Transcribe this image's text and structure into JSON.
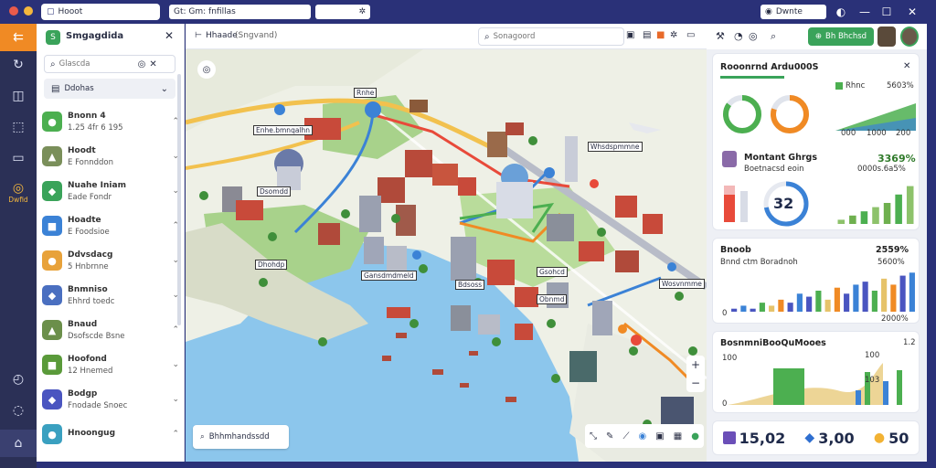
{
  "window": {
    "app_title": "Hooot",
    "tab_title": "Gt: Gm: fnfillas",
    "user_label": "Dwnte"
  },
  "rail": {
    "active_label": "Dwfid",
    "icons": [
      "menu-icon",
      "refresh-icon",
      "layers-icon",
      "puzzle-icon",
      "chat-icon",
      "map-pin-icon",
      "clock-icon",
      "message-icon",
      "home-icon"
    ]
  },
  "sidebar": {
    "title": "Smgagdida",
    "search_placeholder": "Glascda",
    "filter_label": "Ddohas",
    "items": [
      {
        "name": "Bnonn 4",
        "meta": "1.25 4fr 6 195",
        "color": "#4caf50"
      },
      {
        "name": "Hoodt",
        "meta": "E Fonnddon",
        "color": "#7a8f5a"
      },
      {
        "name": "Nuahe Iniam",
        "meta": "Eade Fondr",
        "color": "#3aa35a"
      },
      {
        "name": "Hoadte",
        "meta": "E Foodsioe",
        "color": "#3b82d6"
      },
      {
        "name": "Ddvsdacg",
        "meta": "5 Hnbrnne",
        "color": "#e8a23a"
      },
      {
        "name": "Bnmniso",
        "meta": "Ehhrd toedc",
        "color": "#4a6fc0"
      },
      {
        "name": "Bnaud",
        "meta": "Dsofscde Bsne",
        "color": "#6b8f4a"
      },
      {
        "name": "Hoofond",
        "meta": "12 Hnemed",
        "color": "#5a9a3a"
      },
      {
        "name": "Bodgp",
        "meta": "Fnodade Snoec",
        "color": "#4a55c0"
      },
      {
        "name": "Hnoongug",
        "meta": "",
        "color": "#3aa0c0"
      }
    ]
  },
  "map": {
    "breadcrumb": "Hhaade",
    "breadcrumb_sub": "(Sngvand)",
    "search_placeholder": "Sonagoord",
    "labels": [
      "Rnhe",
      "Enhe.bmnqalhn",
      "Dsomdd",
      "Dhohdp",
      "Whsdspmmne",
      "Gansdmdmeld",
      "Bdsoss",
      "Gsohcd",
      "Obnmd",
      "Wosvnmme"
    ],
    "bottom_search": "Bhhmhandssdd",
    "zoom_in": "+",
    "zoom_out": "−"
  },
  "right": {
    "action_label": "Bh Bhchsd",
    "card1": {
      "title": "Rooonrnd Ardu000S",
      "legend1": "Rhnc",
      "legend1_val": "5603%",
      "donut1_pct": 85,
      "donut2_pct": 80,
      "axis_labels": [
        "000",
        "1000",
        "200"
      ],
      "row2_title": "Montant Ghrgs",
      "row2_sub": "Boetnacsd eoin",
      "row2_val": "3369%",
      "row2_sub_val": "0000s.6a5%",
      "gauge_value": "32",
      "gauge_pct": 72
    },
    "card2": {
      "title": "Bnoob",
      "title_val": "2559%",
      "sub": "Bnnd ctm Boradnoh",
      "sub_val": "5600%",
      "axis_start": "0",
      "axis_end": "2000%"
    },
    "card3": {
      "title": "BosnmniBooQuMooes",
      "tick_top": "1.2",
      "labels": [
        "0",
        "100",
        "100",
        "103"
      ]
    },
    "stats": [
      {
        "icon": "image-icon",
        "value": "15,02",
        "color": "#6b4fb8"
      },
      {
        "icon": "diamond-icon",
        "value": "3,00",
        "color": "#2f6fd0"
      },
      {
        "icon": "coin-icon",
        "value": "50",
        "color": "#f2b233"
      }
    ]
  },
  "chart_data": [
    {
      "type": "donut",
      "title": "",
      "values": [
        85
      ]
    },
    {
      "type": "donut",
      "title": "",
      "values": [
        80
      ]
    },
    {
      "type": "bar",
      "title": "Bnoob",
      "values": [
        1,
        2,
        1,
        3,
        2,
        4,
        3,
        6,
        5,
        7,
        4,
        8,
        6,
        9,
        10,
        7,
        11,
        9,
        12,
        13
      ],
      "ylim": [
        0,
        14
      ]
    },
    {
      "type": "bar",
      "title": "",
      "values": [
        1,
        2,
        3,
        4,
        5,
        7,
        9
      ],
      "ylim": [
        0,
        10
      ]
    }
  ]
}
